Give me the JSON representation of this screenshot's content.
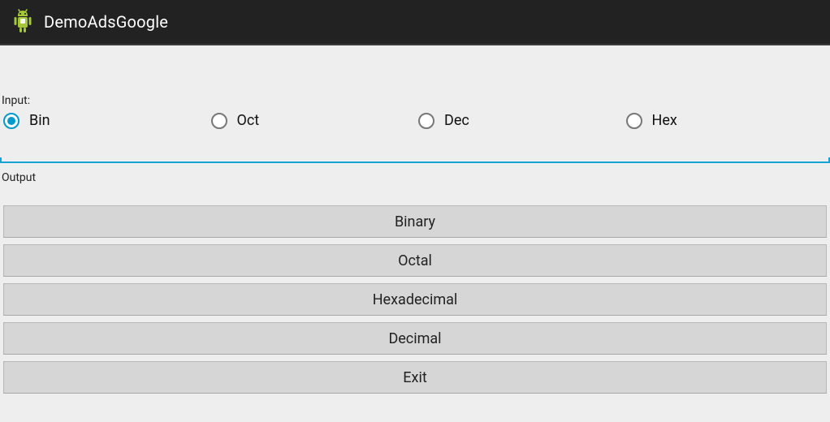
{
  "header": {
    "title": "DemoAdsGoogle"
  },
  "input": {
    "label": "Input:",
    "options": [
      {
        "label": "Bin",
        "checked": true
      },
      {
        "label": "Oct",
        "checked": false
      },
      {
        "label": "Dec",
        "checked": false
      },
      {
        "label": "Hex",
        "checked": false
      }
    ],
    "value": ""
  },
  "output": {
    "label": "Output"
  },
  "buttons": {
    "binary": "Binary",
    "octal": "Octal",
    "hexadecimal": "Hexadecimal",
    "decimal": "Decimal",
    "exit": "Exit"
  }
}
